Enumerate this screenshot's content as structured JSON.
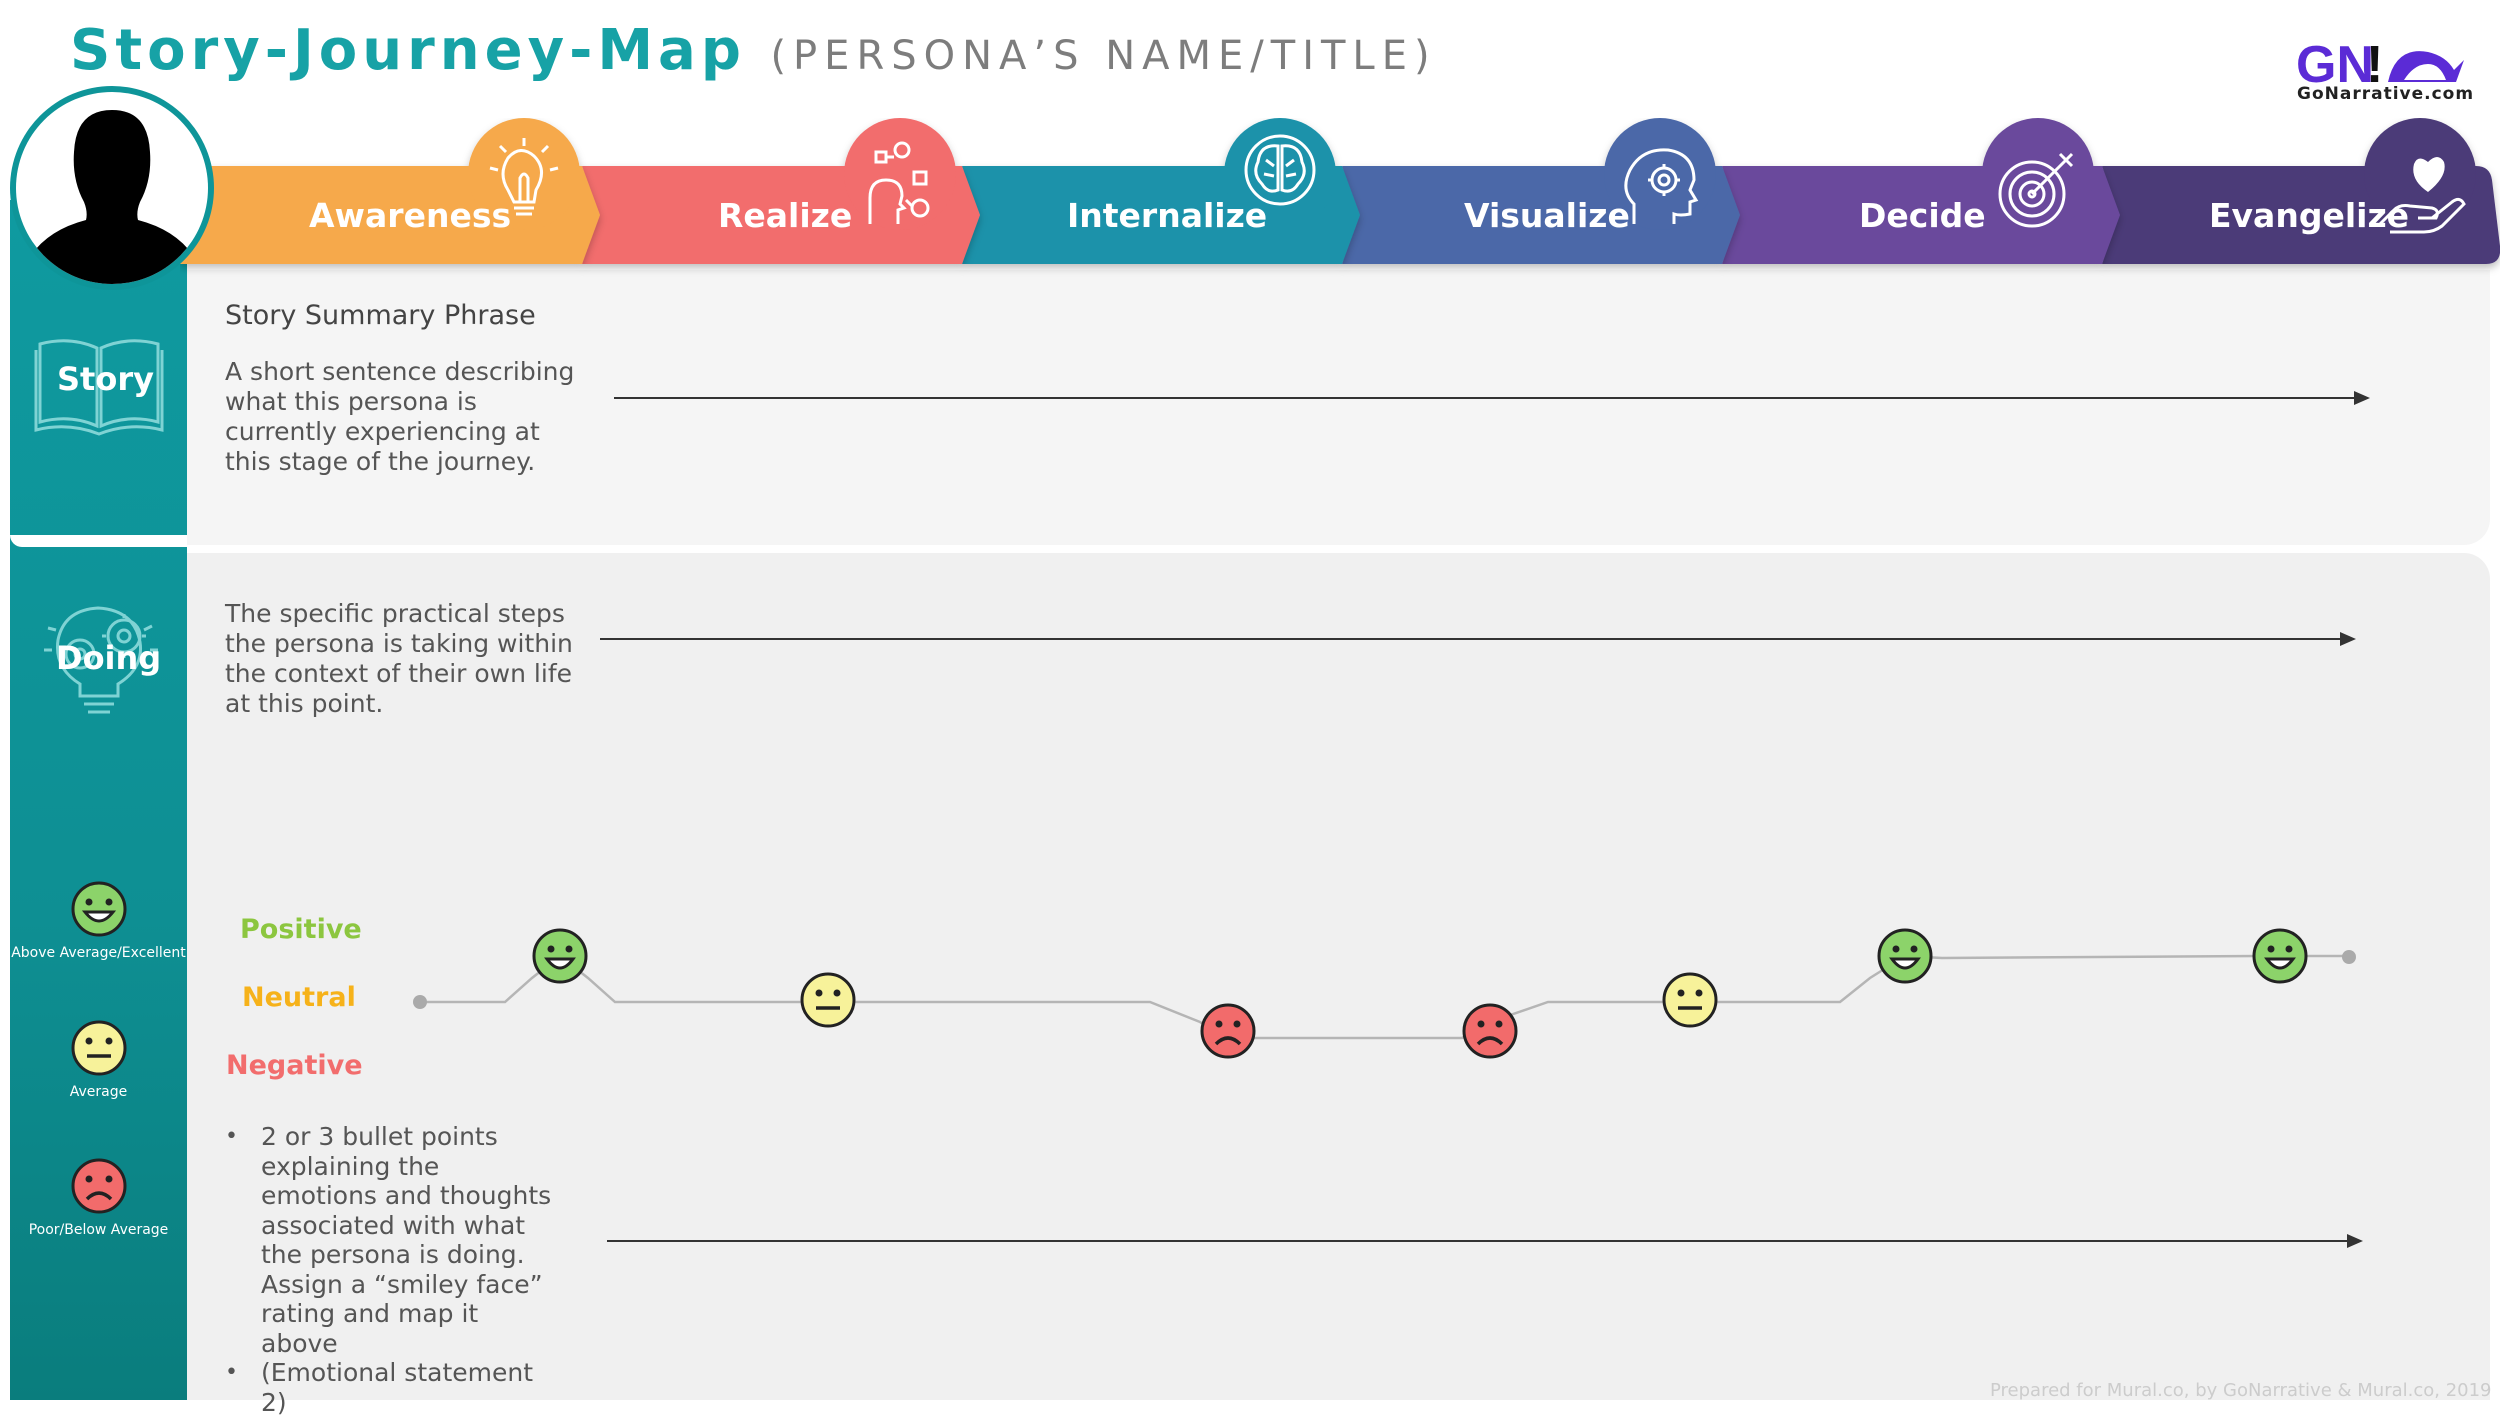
{
  "header": {
    "title": "Story-Journey-Map",
    "subtitle": "(PERSONA’S NAME/TITLE)",
    "logo_text": "GoNarrative.com",
    "logo_mark": "GN!"
  },
  "stages": [
    {
      "label": "Awareness",
      "color": "#f6a94c",
      "icon": "lightbulb-icon"
    },
    {
      "label": "Realize",
      "color": "#f26d6d",
      "icon": "process-head-icon"
    },
    {
      "label": "Internalize",
      "color": "#1b92aa",
      "icon": "brain-icon"
    },
    {
      "label": "Visualize",
      "color": "#4b68a8",
      "icon": "head-gear-icon"
    },
    {
      "label": "Decide",
      "color": "#6a4a9c",
      "icon": "target-icon"
    },
    {
      "label": "Evangelize",
      "color": "#4c3a78",
      "icon": "hand-heart-icon"
    }
  ],
  "sidebar": {
    "story_label": "Story",
    "story_icon": "book-icon",
    "doing_label": "Doing",
    "doing_icon": "lightbulb-gear-icon",
    "legend": [
      {
        "label": "Above Average/Excellent",
        "face": "happy"
      },
      {
        "label": "Average",
        "face": "neutral"
      },
      {
        "label": "Poor/Below Average",
        "face": "sad"
      }
    ]
  },
  "story": {
    "summary_title": "Story Summary Phrase",
    "description": "A short sentence describing what this persona is currently experiencing at this stage of the journey."
  },
  "doing": {
    "description": "The specific practical steps the persona is taking within the context of their own life at this point."
  },
  "emotion_levels": {
    "positive": "Positive",
    "neutral": "Neutral",
    "negative": "Negative"
  },
  "emotion_points": [
    "happy",
    "neutral",
    "sad",
    "sad",
    "neutral",
    "happy",
    "happy"
  ],
  "colors": {
    "teal": "#17a2a6",
    "positive": "#8cc63f",
    "neutral": "#f6b21a",
    "negative": "#f26d6d",
    "happy_face": "#8cd36a",
    "neutral_face": "#f7f29a",
    "sad_face": "#f26b6b"
  },
  "emotions_bullets": [
    "2 or 3 bullet points explaining the emotions and thoughts associated with what the persona is doing. Assign a “smiley face” rating and map it above",
    "(Emotional statement 2)"
  ],
  "footer": "Prepared for Mural.co, by GoNarrative & Mural.co, 2019"
}
